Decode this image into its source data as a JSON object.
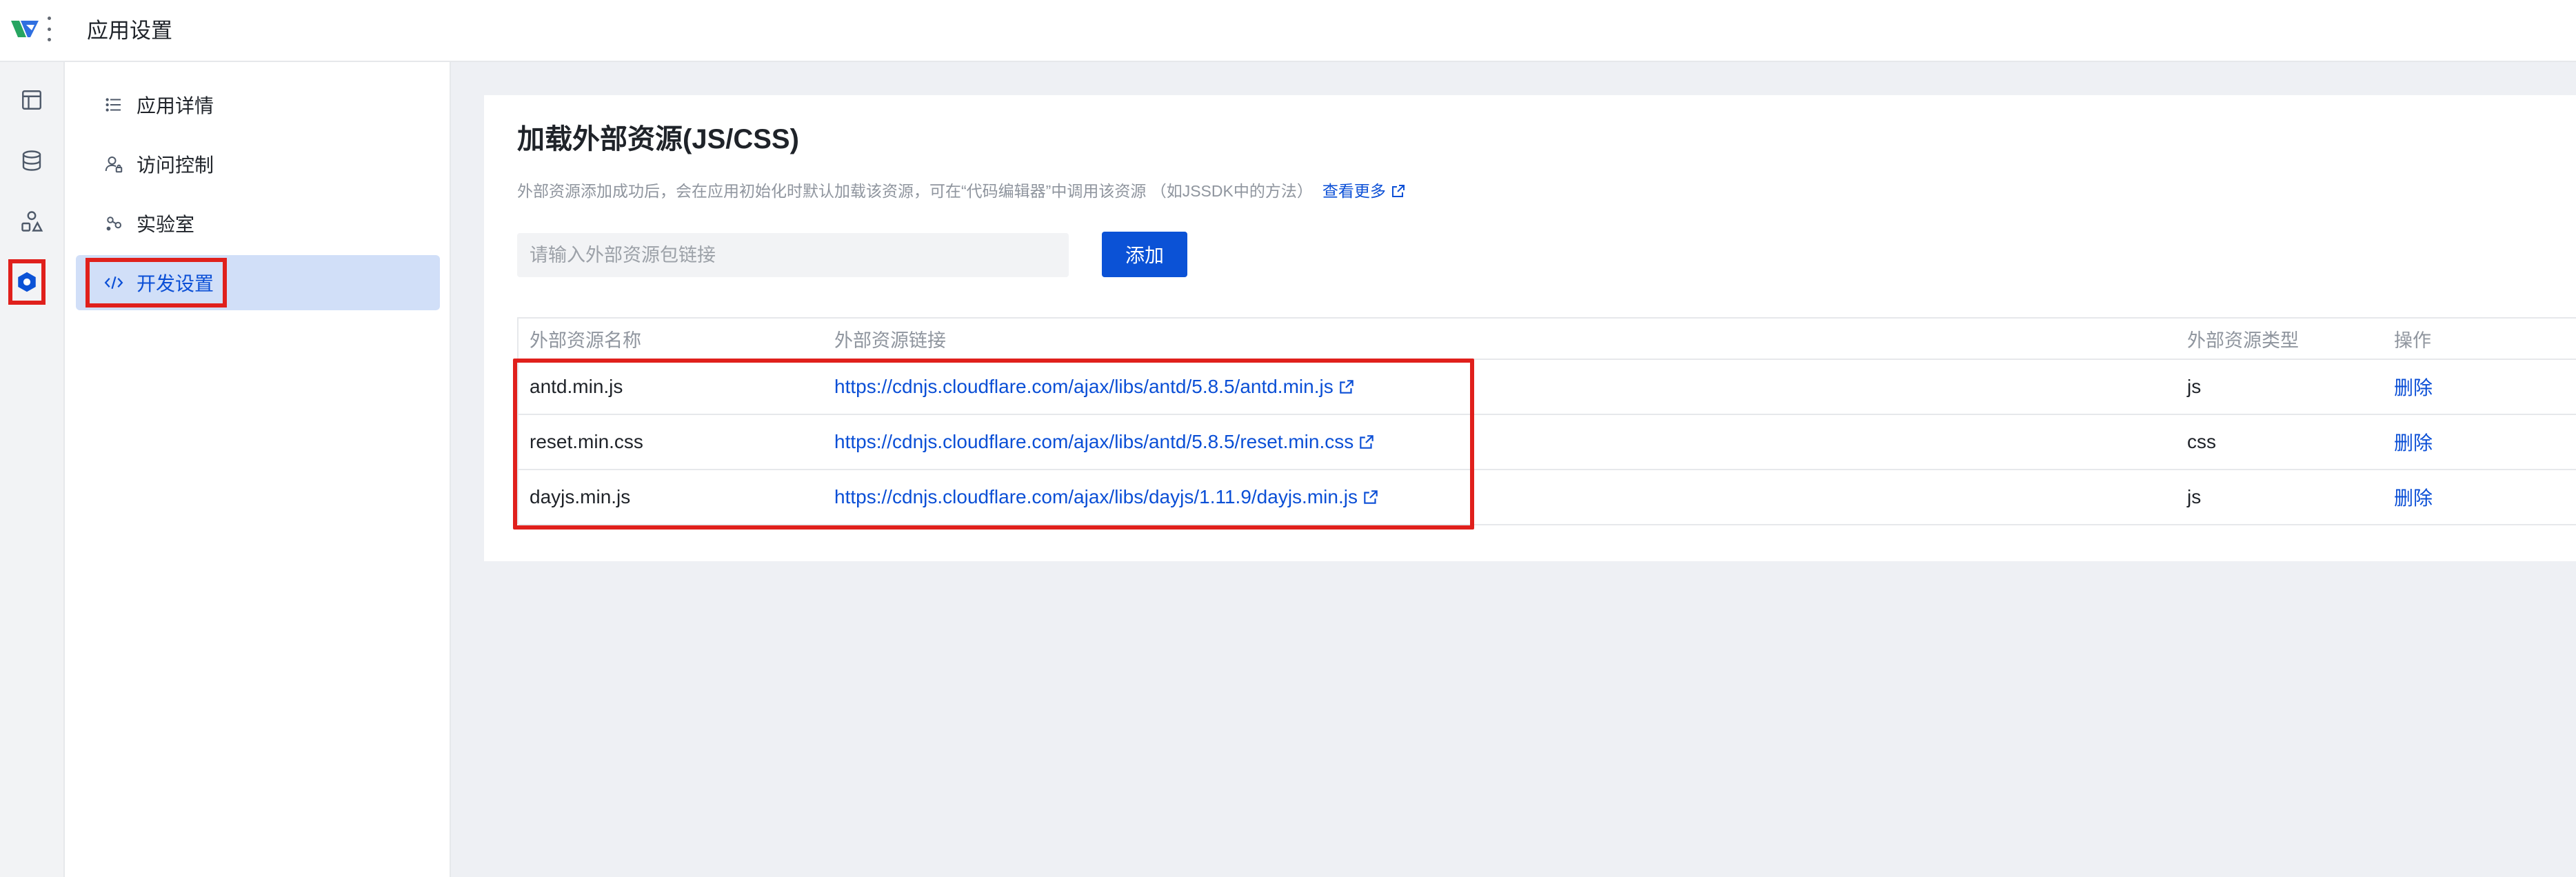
{
  "header": {
    "title": "应用设置",
    "logo_icon": "app-logo-icon",
    "more_icon": "kebab-menu-icon"
  },
  "rail": {
    "items": [
      {
        "icon": "layout-icon"
      },
      {
        "icon": "database-icon"
      },
      {
        "icon": "shapes-icon"
      },
      {
        "icon": "settings-hexagon-icon",
        "active": true
      }
    ]
  },
  "sidebar": {
    "items": [
      {
        "label": "应用详情",
        "icon": "list-icon"
      },
      {
        "label": "访问控制",
        "icon": "user-lock-icon"
      },
      {
        "label": "实验室",
        "icon": "lab-icon"
      },
      {
        "label": "开发设置",
        "icon": "code-icon",
        "active": true
      }
    ]
  },
  "section": {
    "title": "加载外部资源(JS/CSS)",
    "description": "外部资源添加成功后，会在应用初始化时默认加载该资源，可在“代码编辑器”中调用该资源 （如JSSDK中的方法）",
    "more_link": "查看更多"
  },
  "input": {
    "placeholder": "请输入外部资源包链接",
    "value": ""
  },
  "add_button": "添加",
  "table": {
    "columns": [
      "外部资源名称",
      "外部资源链接",
      "外部资源类型",
      "操作"
    ],
    "rows": [
      {
        "name": "antd.min.js",
        "url": "https://cdnjs.cloudflare.com/ajax/libs/antd/5.8.5/antd.min.js",
        "type": "js",
        "action": "删除"
      },
      {
        "name": "reset.min.css",
        "url": "https://cdnjs.cloudflare.com/ajax/libs/antd/5.8.5/reset.min.css",
        "type": "css",
        "action": "删除"
      },
      {
        "name": "dayjs.min.js",
        "url": "https://cdnjs.cloudflare.com/ajax/libs/dayjs/1.11.9/dayjs.min.js",
        "type": "js",
        "action": "删除"
      }
    ]
  },
  "colors": {
    "accent": "#0b52d6",
    "annotation": "#e0201c",
    "active_bg": "#d1dff8"
  }
}
